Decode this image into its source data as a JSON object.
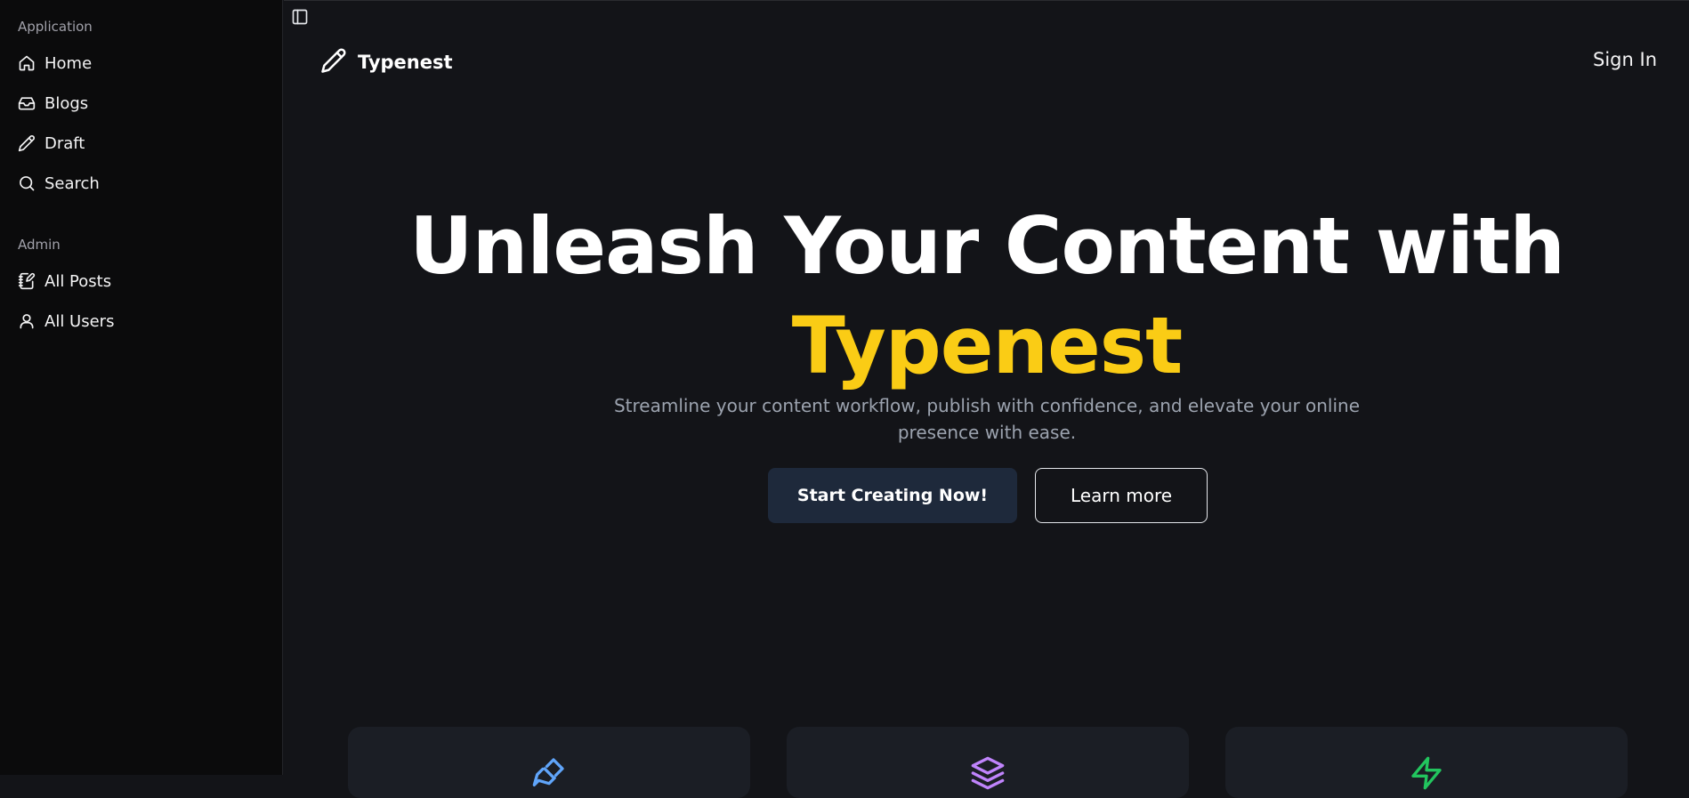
{
  "sidebar": {
    "groups": [
      {
        "label": "Application",
        "items": [
          {
            "label": "Home",
            "icon": "home-icon"
          },
          {
            "label": "Blogs",
            "icon": "inbox-icon"
          },
          {
            "label": "Draft",
            "icon": "pencil-icon"
          },
          {
            "label": "Search",
            "icon": "search-icon"
          }
        ]
      },
      {
        "label": "Admin",
        "items": [
          {
            "label": "All Posts",
            "icon": "notebook-pen-icon"
          },
          {
            "label": "All Users",
            "icon": "user-icon"
          }
        ]
      }
    ]
  },
  "header": {
    "brand": "Typenest",
    "brand_icon": "pencil-icon",
    "sign_in": "Sign In"
  },
  "hero": {
    "title_line1": "Unleash Your Content with",
    "title_accent": "Typenest",
    "subtitle": "Streamline your content workflow, publish with confidence, and elevate your online presence with ease.",
    "primary_cta": "Start Creating Now!",
    "secondary_cta": "Learn more"
  },
  "features": [
    {
      "icon": "pen-tool-icon",
      "color": "#60a5fa"
    },
    {
      "icon": "layers-icon",
      "color": "#c084fc"
    },
    {
      "icon": "zap-icon",
      "color": "#22c55e"
    }
  ],
  "colors": {
    "accent": "#facc15",
    "primary_button": "#1e293b",
    "background": "#131418",
    "sidebar": "#0b0b0c"
  }
}
